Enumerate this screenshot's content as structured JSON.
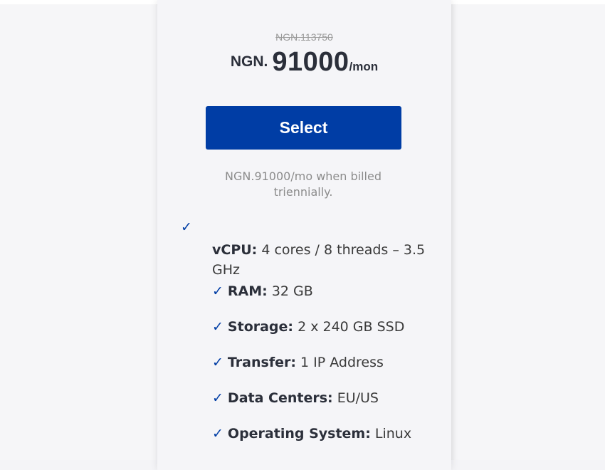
{
  "plan": {
    "old_price": "NGN.113750",
    "currency": "NGN.",
    "price": "91000",
    "period": "/mon",
    "select_label": "Select",
    "billing_note": "NGN.91000/mo when billed triennially."
  },
  "features": {
    "check_symbol": "✓",
    "vcpu": {
      "label": "vCPU:",
      "value": "4 cores / 8 threads – 3.5 GHz"
    },
    "ram": {
      "label": "RAM:",
      "value": "32 GB"
    },
    "storage": {
      "label": "Storage:",
      "value": "2 x 240 GB SSD"
    },
    "transfer": {
      "label": "Transfer:",
      "value": "1 IP Address"
    },
    "data_centers": {
      "label": "Data Centers:",
      "value": "EU/US"
    },
    "os": {
      "label": "Operating System:",
      "value": "Linux"
    }
  },
  "colors": {
    "accent": "#003da5",
    "price_text": "#2b2f3a",
    "muted_text": "#8c8c8c"
  }
}
